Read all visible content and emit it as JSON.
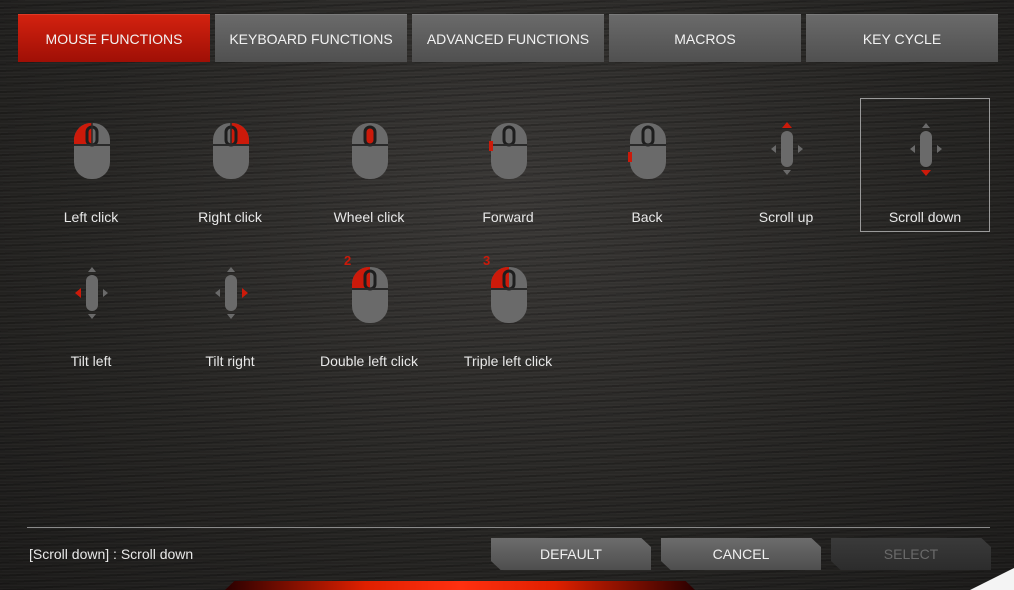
{
  "tabs": [
    {
      "label": "MOUSE FUNCTIONS",
      "active": true
    },
    {
      "label": "KEYBOARD FUNCTIONS"
    },
    {
      "label": "ADVANCED FUNCTIONS"
    },
    {
      "label": "MACROS"
    },
    {
      "label": "KEY CYCLE"
    }
  ],
  "functions": [
    {
      "label": "Left click",
      "icon": "mouse-left-click-icon"
    },
    {
      "label": "Right click",
      "icon": "mouse-right-click-icon"
    },
    {
      "label": "Wheel click",
      "icon": "mouse-wheel-click-icon"
    },
    {
      "label": "Forward",
      "icon": "mouse-forward-icon"
    },
    {
      "label": "Back",
      "icon": "mouse-back-icon"
    },
    {
      "label": "Scroll up",
      "icon": "scroll-up-icon"
    },
    {
      "label": "Scroll down",
      "icon": "scroll-down-icon",
      "selected": true
    },
    {
      "label": "Tilt left",
      "icon": "tilt-left-icon"
    },
    {
      "label": "Tilt right",
      "icon": "tilt-right-icon"
    },
    {
      "label": "Double left click",
      "icon": "mouse-double-left-click-icon",
      "badge": "2"
    },
    {
      "label": "Triple left click",
      "icon": "mouse-triple-left-click-icon",
      "badge": "3"
    }
  ],
  "status": {
    "text": "[Scroll down] : Scroll down"
  },
  "buttons": {
    "default": "DEFAULT",
    "cancel": "CANCEL",
    "select": "SELECT"
  },
  "colors": {
    "accent": "#cc1a0a",
    "tab_inactive": "#5c5c5c",
    "icon_gray": "#6a6a6a"
  }
}
